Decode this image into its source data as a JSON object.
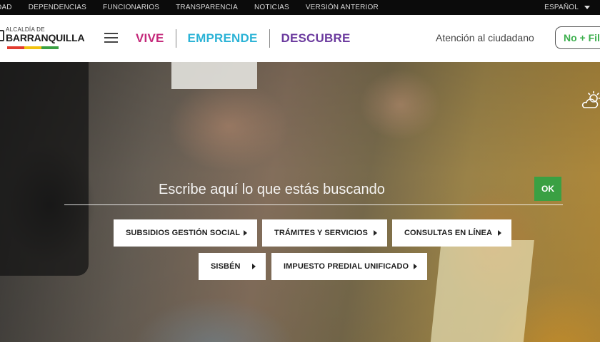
{
  "topbar": {
    "links": [
      "DAD",
      "DEPENDENCIAS",
      "FUNCIONARIOS",
      "TRANSPARENCIA",
      "NOTICIAS",
      "VERSIÓN ANTERIOR"
    ],
    "language": "ESPAÑOL"
  },
  "header": {
    "logo_small": "ALCALDÍA DE",
    "logo_big": "BARRANQUILLA",
    "nav": [
      {
        "label": "VIVE",
        "color": "#c4287a"
      },
      {
        "label": "EMPRENDE",
        "color": "#2bb3d6"
      },
      {
        "label": "DESCUBRE",
        "color": "#6b3a9e"
      }
    ],
    "atencion": "Atención al ciudadano",
    "nofile": "No + Fila"
  },
  "search": {
    "placeholder": "Escribe aquí lo que estás buscando",
    "ok_label": "OK"
  },
  "quick_links": [
    {
      "label": "SUBSIDIOS GESTIÓN SOCIAL"
    },
    {
      "label": "TRÁMITES Y SERVICIOS"
    },
    {
      "label": "CONSULTAS EN LÍNEA"
    },
    {
      "label": "SISBÉN"
    },
    {
      "label": "IMPUESTO PREDIAL UNIFICADO"
    }
  ],
  "colors": {
    "flag": [
      "#e23b2e",
      "#f2c20f",
      "#3aa043"
    ],
    "ok_green": "#3aa043"
  },
  "icons": {
    "weather": "partly-cloudy-icon",
    "menu": "hamburger-menu-icon",
    "language": "chevron-down-icon"
  }
}
